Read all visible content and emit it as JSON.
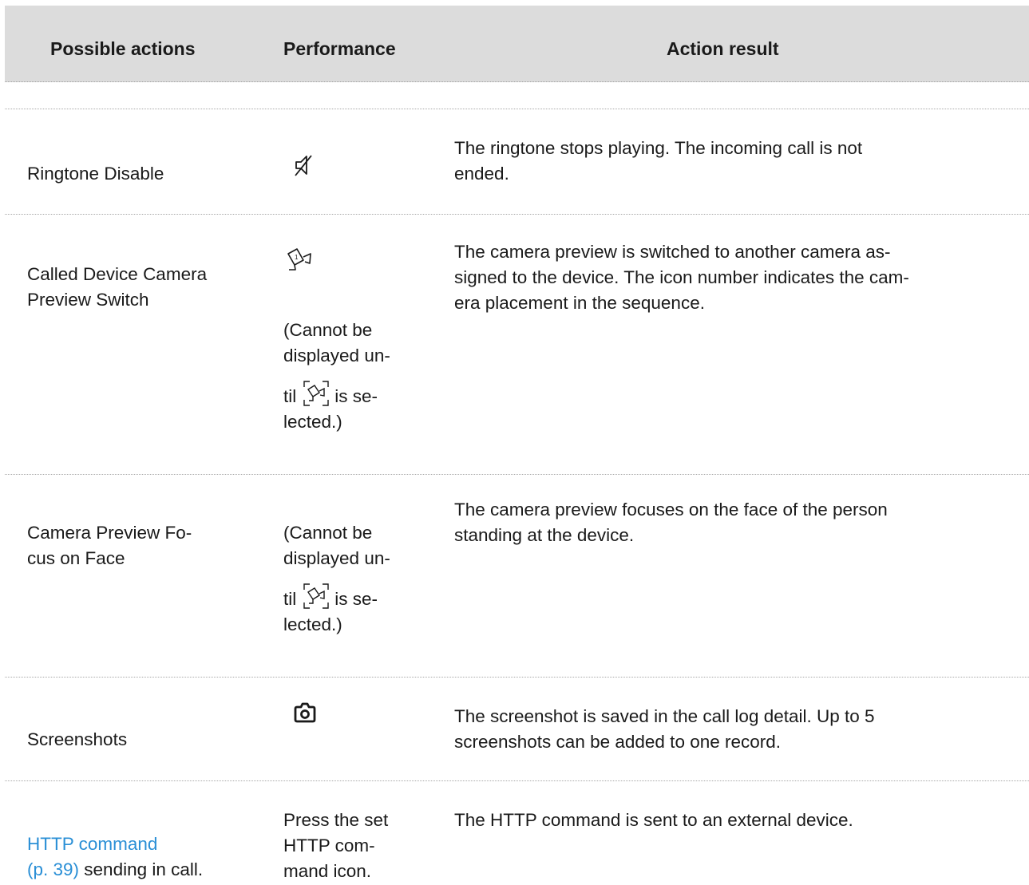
{
  "header": {
    "col1": "Possible actions",
    "col2": "Performance",
    "col3": "Action result"
  },
  "rows": [
    {
      "action": "Ringtone Disable",
      "performance_icon": "ringtone-mute-icon",
      "result": [
        "The ringtone stops playing. The incoming call is not",
        "ended."
      ]
    },
    {
      "action": [
        "Called Device Camera",
        "Preview Switch"
      ],
      "performance_icon": "camera-switch-icon",
      "performance_note": [
        "(Cannot be",
        "displayed un-",
        "til",
        "is se-",
        "lected.)"
      ],
      "note_icon": "camera-preview-frame-icon",
      "result": [
        "The camera preview is switched to another camera as-",
        "signed to the device. The icon number indicates the cam-",
        "era placement in the sequence."
      ]
    },
    {
      "action": [
        "Camera Preview Fo-",
        "cus on Face"
      ],
      "performance_note": [
        "(Cannot be",
        "displayed un-",
        "til",
        "is se-",
        "lected.)"
      ],
      "note_icon": "camera-preview-frame-icon",
      "result": [
        "The camera preview focuses on the face of the person",
        "standing at the device."
      ]
    },
    {
      "action": "Screenshots",
      "performance_icon": "camera-screenshot-icon",
      "result": [
        "The screenshot is saved in the call log detail. Up to 5",
        "screenshots can be added to one record."
      ]
    },
    {
      "action_link": [
        "HTTP command",
        "(p. 39)"
      ],
      "action_suffix": "sending in call.",
      "performance": [
        "Press the set",
        "HTTP com-",
        "mand icon."
      ],
      "result": [
        "The HTTP command is sent to an external device."
      ]
    }
  ],
  "colors": {
    "header_bg": "#dcdcdc",
    "link": "#2a8fd6",
    "text": "#1a1a1a"
  }
}
